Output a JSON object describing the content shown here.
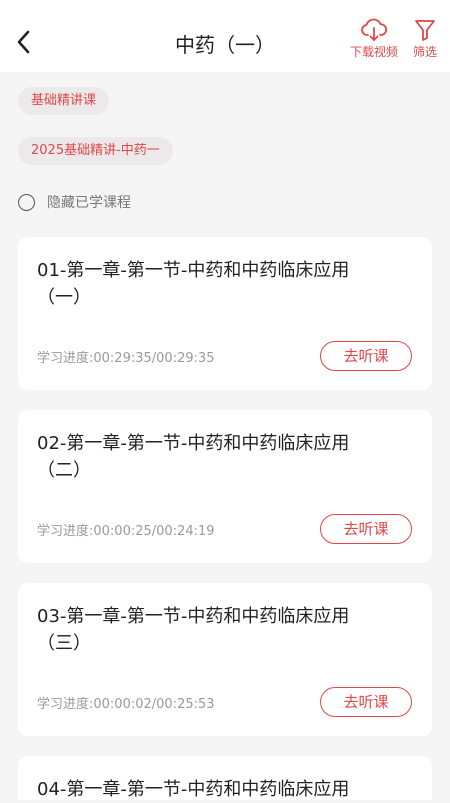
{
  "header": {
    "title": "中药（一）",
    "download_label": "下载视频",
    "filter_label": "筛选"
  },
  "filters": {
    "chip_1": "基础精讲课",
    "chip_2": "2025基础精讲-中药一"
  },
  "hide_learned_label": "隐藏已学课程",
  "lessons": [
    {
      "title": "01-第一章-第一节-中药和中药临床应用（一）",
      "progress": "学习进度:00:29:35/00:29:35",
      "button": "去听课"
    },
    {
      "title": "02-第一章-第一节-中药和中药临床应用（二）",
      "progress": "学习进度:00:00:25/00:24:19",
      "button": "去听课"
    },
    {
      "title": "03-第一章-第一节-中药和中药临床应用（三）",
      "progress": "学习进度:00:00:02/00:25:53",
      "button": "去听课"
    },
    {
      "title": "04-第一章-第一节-中药和中药临床应用",
      "progress": "",
      "button": ""
    }
  ],
  "colors": {
    "accent": "#e04848",
    "background": "#f5f5f5",
    "chip_bg": "#ebe9e9"
  }
}
